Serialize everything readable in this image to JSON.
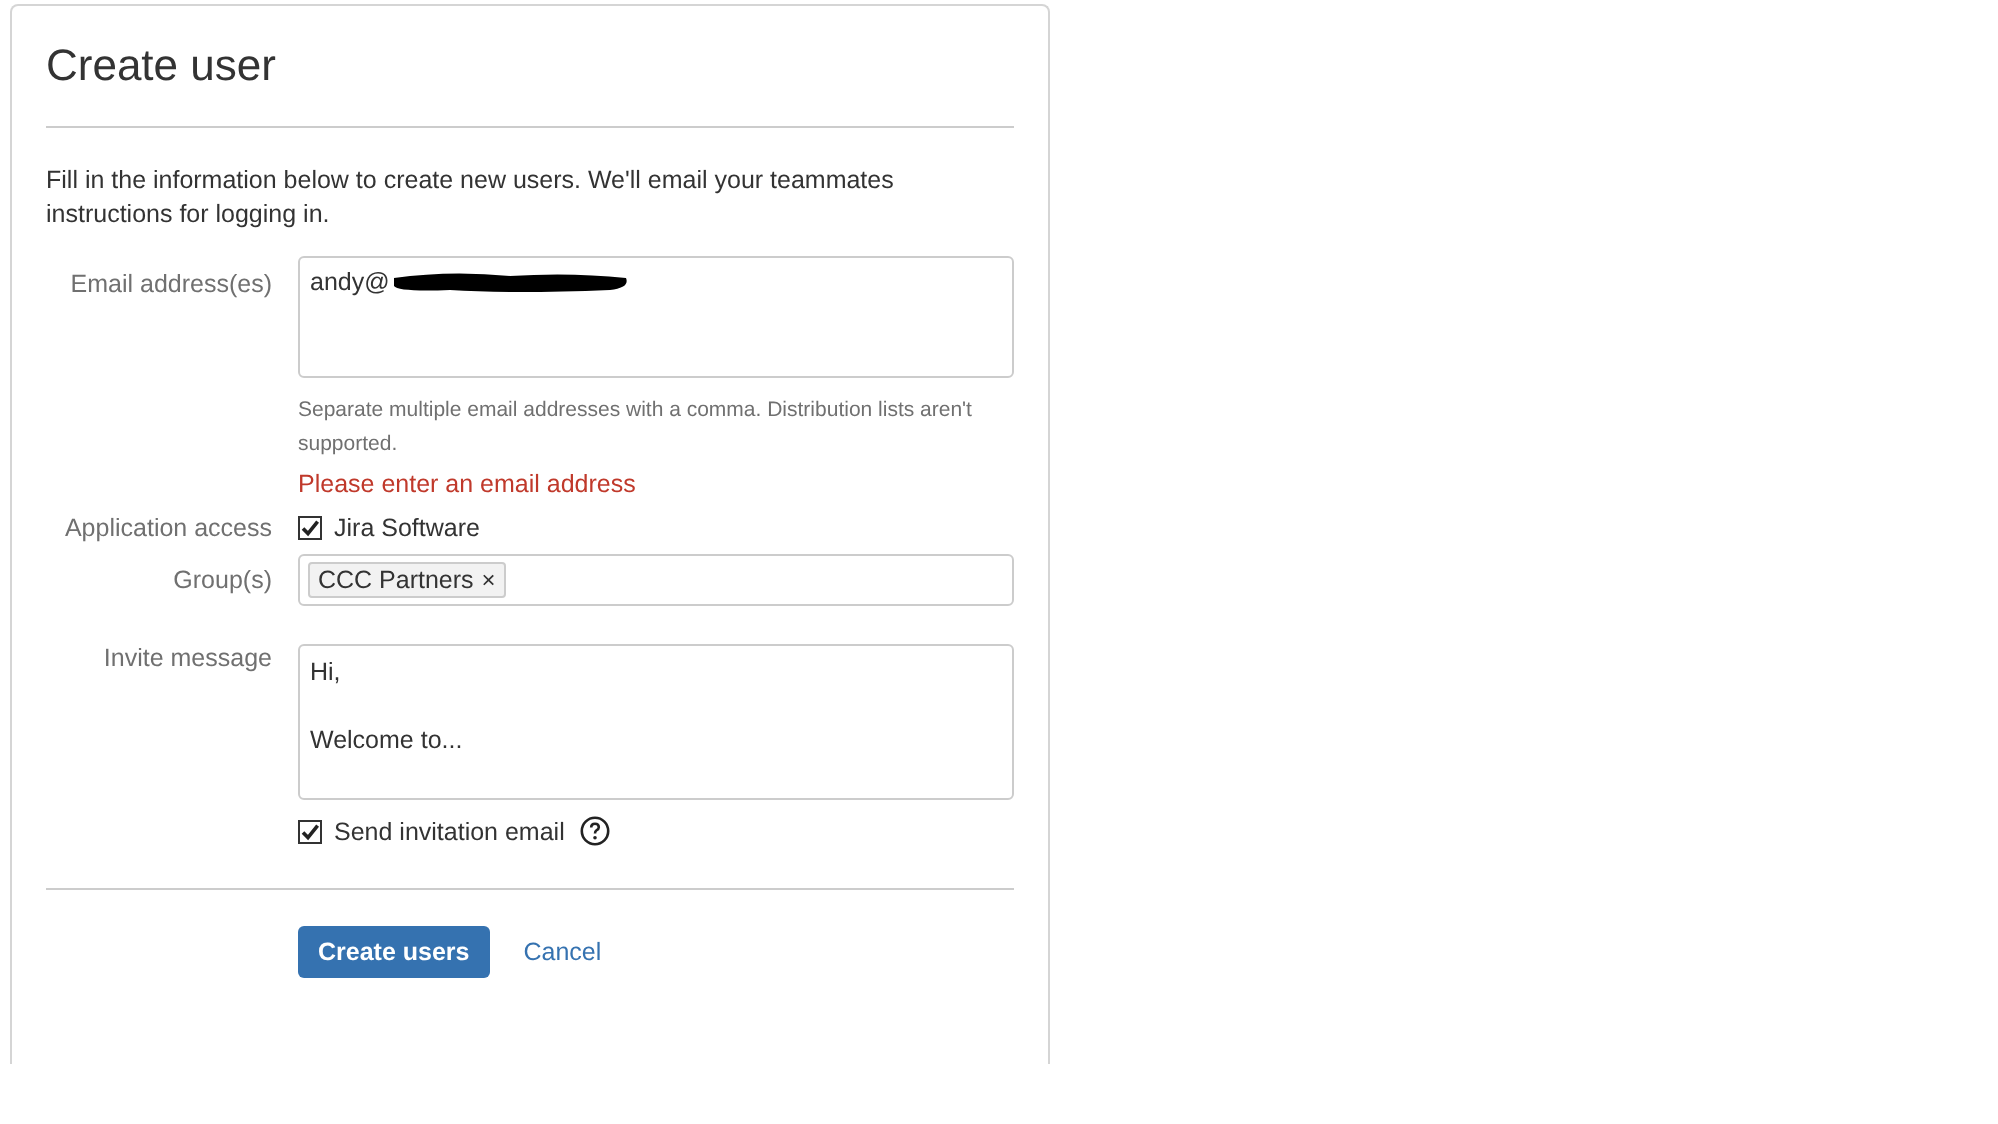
{
  "dialog": {
    "title": "Create user",
    "intro": "Fill in the information below to create new users. We'll email your teammates instructions for logging in."
  },
  "email": {
    "label": "Email address(es)",
    "value": "andy@",
    "redacted": true,
    "help": "Separate multiple email addresses with a comma. Distribution lists aren't supported.",
    "error": "Please enter an email address"
  },
  "application_access": {
    "label": "Application access",
    "options": [
      {
        "label": "Jira Software",
        "checked": true
      }
    ]
  },
  "groups": {
    "label": "Group(s)",
    "tags": [
      {
        "label": "CCC Partners",
        "remove": "×"
      }
    ]
  },
  "invite": {
    "label": "Invite message",
    "value": "Hi,\n\nWelcome to...",
    "send": {
      "label": "Send invitation email",
      "checked": true
    }
  },
  "buttons": {
    "submit": "Create users",
    "cancel": "Cancel"
  }
}
